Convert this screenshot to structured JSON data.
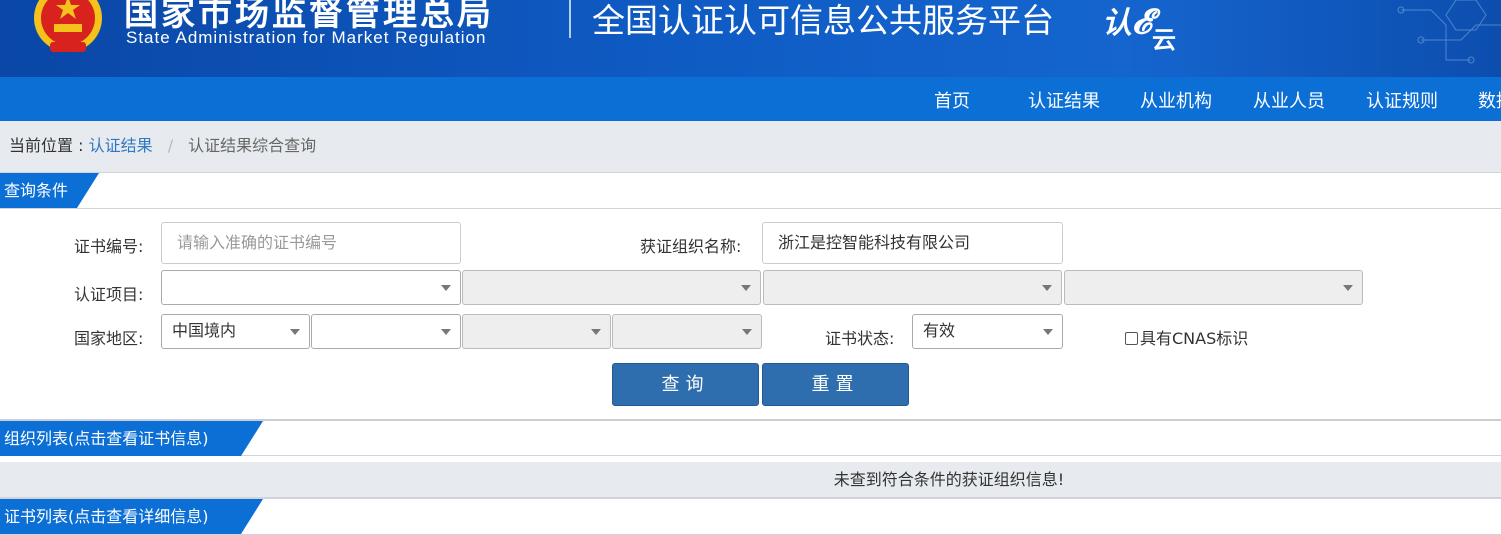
{
  "header": {
    "title_cn": "国家市场监督管理总局",
    "title_en": "State Administration  for  Market Regulation",
    "platform": "全国认证认可信息公共服务平台",
    "logo_main": "认",
    "logo_sub": "云",
    "emblem_icon": "national-emblem-icon",
    "colors": {
      "banner": "#0f5bc4",
      "nav": "#0b6fd6",
      "button": "#2f6eae"
    }
  },
  "nav": {
    "items": [
      "首页",
      "认证结果",
      "从业机构",
      "从业人员",
      "认证规则",
      "数据"
    ]
  },
  "breadcrumb": {
    "label": "当前位置 :",
    "link": "认证结果",
    "separator": "/",
    "current": "认证结果综合查询"
  },
  "query": {
    "section_title": "查询条件",
    "cert_no_label": "证书编号:",
    "cert_no_placeholder": "请输入准确的证书编号",
    "org_name_label": "获证组织名称:",
    "org_name_value": "浙江是控智能科技有限公司",
    "project_label": "认证项目:",
    "project_selects": [
      "",
      "",
      "",
      ""
    ],
    "region_label": "国家地区:",
    "region_selects": [
      "中国境内",
      "",
      "",
      ""
    ],
    "status_label": "证书状态:",
    "status_value": "有效",
    "cnas_label": "具有CNAS标识",
    "search_button": "查询",
    "reset_button": "重置"
  },
  "org_list": {
    "section_title": "组织列表(点击查看证书信息)",
    "empty_message": "未查到符合条件的获证组织信息!"
  },
  "cert_list": {
    "section_title": "证书列表(点击查看详细信息)"
  }
}
